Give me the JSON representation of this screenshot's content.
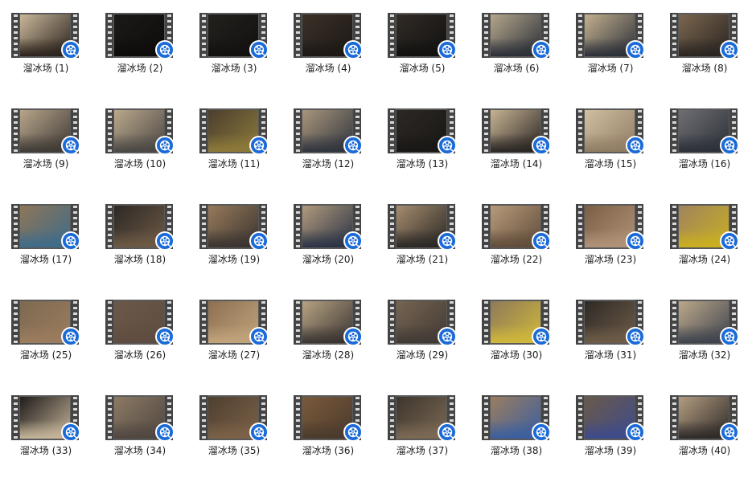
{
  "folder": {
    "item_icon": "video-file-icon",
    "badge_icon": "film-reel-icon",
    "accent_color": "#1a6ad7",
    "files": [
      {
        "label": "溜冰场 (1)",
        "tone": [
          "#c9b79a",
          "#2a221c"
        ]
      },
      {
        "label": "溜冰场 (2)",
        "tone": [
          "#1c1a18",
          "#0e0c0b"
        ]
      },
      {
        "label": "溜冰场 (3)",
        "tone": [
          "#23201d",
          "#121110"
        ]
      },
      {
        "label": "溜冰场 (4)",
        "tone": [
          "#3a3028",
          "#1d1815"
        ]
      },
      {
        "label": "溜冰场 (5)",
        "tone": [
          "#312b26",
          "#121110"
        ]
      },
      {
        "label": "溜冰场 (6)",
        "tone": [
          "#b5a68c",
          "#2b2f38"
        ]
      },
      {
        "label": "溜冰场 (7)",
        "tone": [
          "#c3b08e",
          "#2c3039"
        ]
      },
      {
        "label": "溜冰场 (8)",
        "tone": [
          "#7b6650",
          "#2a2521"
        ]
      },
      {
        "label": "溜冰场 (9)",
        "tone": [
          "#b7a58a",
          "#3f3a35"
        ]
      },
      {
        "label": "溜冰场 (10)",
        "tone": [
          "#bba88c",
          "#4a4744"
        ]
      },
      {
        "label": "溜冰场 (11)",
        "tone": [
          "#4b3e2f",
          "#8d7a3a"
        ]
      },
      {
        "label": "溜冰场 (12)",
        "tone": [
          "#a8967c",
          "#30343d"
        ]
      },
      {
        "label": "溜冰场 (13)",
        "tone": [
          "#2c2824",
          "#191715"
        ]
      },
      {
        "label": "溜冰场 (14)",
        "tone": [
          "#c7b394",
          "#2a2623"
        ]
      },
      {
        "label": "溜冰场 (15)",
        "tone": [
          "#d1bfa2",
          "#8f7c63"
        ]
      },
      {
        "label": "溜冰场 (16)",
        "tone": [
          "#6e6f73",
          "#2c3038"
        ]
      },
      {
        "label": "溜冰场 (17)",
        "tone": [
          "#8d7658",
          "#3e6b8a"
        ]
      },
      {
        "label": "溜冰场 (18)",
        "tone": [
          "#2d2825",
          "#6d5a45"
        ]
      },
      {
        "label": "溜冰场 (19)",
        "tone": [
          "#967a5a",
          "#3a3330"
        ]
      },
      {
        "label": "溜冰场 (20)",
        "tone": [
          "#b09a7c",
          "#2a3346"
        ]
      },
      {
        "label": "溜冰场 (21)",
        "tone": [
          "#a58c6d",
          "#2a2725"
        ]
      },
      {
        "label": "溜冰场 (22)",
        "tone": [
          "#b89a7a",
          "#5f4c3a"
        ]
      },
      {
        "label": "溜冰场 (23)",
        "tone": [
          "#7c5e45",
          "#b09378"
        ]
      },
      {
        "label": "溜冰场 (24)",
        "tone": [
          "#a0835e",
          "#c9b020"
        ]
      },
      {
        "label": "溜冰场 (25)",
        "tone": [
          "#7c6a51",
          "#9c7c5e"
        ]
      },
      {
        "label": "溜冰场 (26)",
        "tone": [
          "#6a5848",
          "#5e4c40"
        ]
      },
      {
        "label": "溜冰场 (27)",
        "tone": [
          "#8c7052",
          "#c2a47c"
        ]
      },
      {
        "label": "溜冰场 (28)",
        "tone": [
          "#b7a283",
          "#3a3532"
        ]
      },
      {
        "label": "溜冰场 (29)",
        "tone": [
          "#766450",
          "#413a35"
        ]
      },
      {
        "label": "溜冰场 (30)",
        "tone": [
          "#8e7a5a",
          "#d0b83a"
        ]
      },
      {
        "label": "溜冰场 (31)",
        "tone": [
          "#2e2a26",
          "#6e5c48"
        ]
      },
      {
        "label": "溜冰场 (32)",
        "tone": [
          "#bca88a",
          "#3e434e"
        ]
      },
      {
        "label": "溜冰场 (33)",
        "tone": [
          "#1f1c1a",
          "#c6b59a"
        ]
      },
      {
        "label": "溜冰场 (34)",
        "tone": [
          "#8c7a64",
          "#4f4640"
        ]
      },
      {
        "label": "溜冰场 (35)",
        "tone": [
          "#4e3f30",
          "#7c6248"
        ]
      },
      {
        "label": "溜冰场 (36)",
        "tone": [
          "#7a5a3c",
          "#4a3a2c"
        ]
      },
      {
        "label": "溜冰场 (37)",
        "tone": [
          "#3d352d",
          "#7c6a54"
        ]
      },
      {
        "label": "溜冰场 (38)",
        "tone": [
          "#9a7e60",
          "#3a5ea0"
        ]
      },
      {
        "label": "溜冰场 (39)",
        "tone": [
          "#6a5a4a",
          "#3e4b8c"
        ]
      },
      {
        "label": "溜冰场 (40)",
        "tone": [
          "#b29c80",
          "#2e2a28"
        ]
      }
    ]
  }
}
